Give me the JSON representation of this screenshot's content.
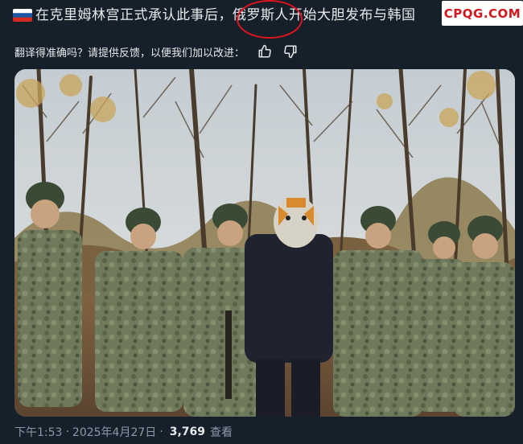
{
  "post": {
    "flag_icon": "russia-flag-icon",
    "text": "在克里姆林宫正式承认此事后，俄罗斯人开始大胆发布与韩国"
  },
  "watermark": {
    "text": "CPQG.COM"
  },
  "translate": {
    "prompt": "翻译得准确吗？请提供反馈，以便我们加以改进：",
    "thumb_up_icon": "thumbs-up-icon",
    "thumb_down_icon": "thumbs-down-icon"
  },
  "meta": {
    "time": "下午1:53",
    "separator": "·",
    "date": "2025年4月27日",
    "views_count": "3,769",
    "views_label": "查看"
  },
  "colors": {
    "background": "#15202b",
    "text": "#e7e9ea",
    "muted": "#8b98a5",
    "highlight_circle": "#e0141e",
    "watermark": "#d4161d"
  }
}
